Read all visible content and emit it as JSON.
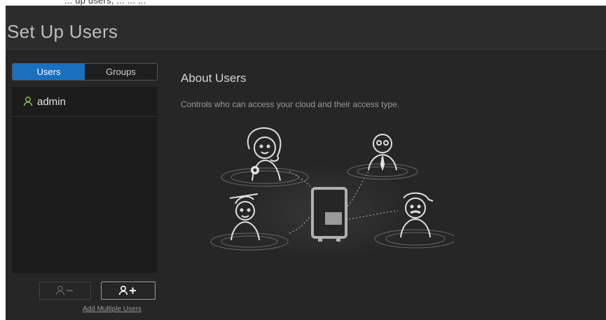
{
  "header": {
    "top_strip_text": "... up users, ... ... ...",
    "title": "Set Up Users"
  },
  "tabs": [
    {
      "label": "Users",
      "active": true
    },
    {
      "label": "Groups",
      "active": false
    }
  ],
  "users": [
    {
      "name": "admin",
      "icon": "user-icon"
    }
  ],
  "actions": {
    "remove_user_icon": "user-minus-icon",
    "add_user_icon": "user-plus-icon",
    "add_multiple_label": "Add Multiple Users"
  },
  "about": {
    "title": "About Users",
    "description": "Controls who can access your cloud and their access type."
  },
  "colors": {
    "accent": "#1a6fbf",
    "background": "#262626",
    "user_icon": "#7fc24a"
  }
}
